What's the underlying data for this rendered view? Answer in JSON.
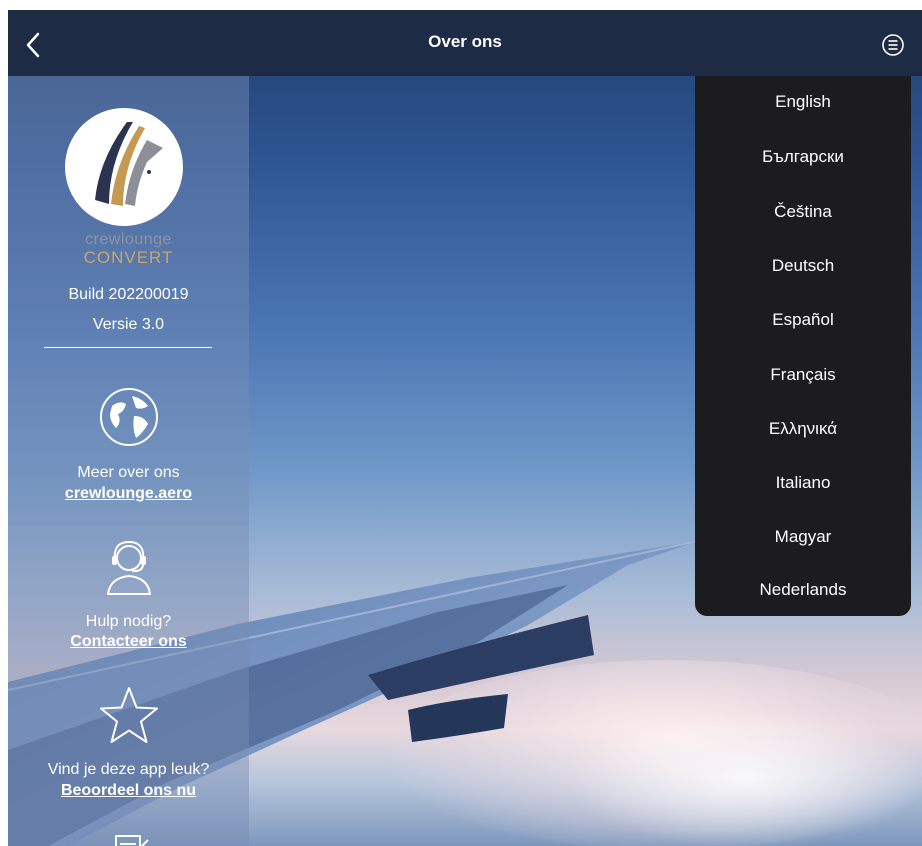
{
  "header": {
    "title": "Over ons"
  },
  "sidebar": {
    "brand_line1": "crewlounge",
    "brand_line2": "CONVERT",
    "build": "Build 202200019",
    "version": "Versie 3.0",
    "about": {
      "text": "Meer over ons",
      "link": "crewlounge.aero"
    },
    "help": {
      "text": "Hulp nodig?",
      "link": "Contacteer ons"
    },
    "rate": {
      "text": "Vind je deze app leuk?",
      "link": "Beoordeel ons nu"
    }
  },
  "languages": [
    "English",
    "Български",
    "Čeština",
    "Deutsch",
    "Español",
    "Français",
    "Ελληνικά",
    "Italiano",
    "Magyar",
    "Nederlands"
  ],
  "colors": {
    "header": "#1e2b44",
    "dropdown": "#1c1c1e",
    "brand_gold": "#c9a667",
    "brand_grey": "#8e93a6"
  }
}
